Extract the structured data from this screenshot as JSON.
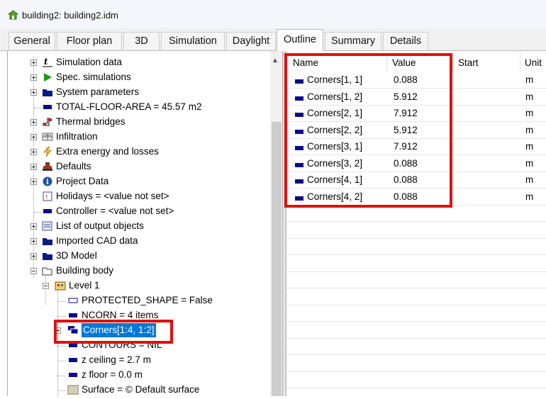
{
  "window": {
    "title": "building2: building2.idm"
  },
  "tabs": [
    "General",
    "Floor plan",
    "3D",
    "Simulation",
    "Daylight",
    "Outline",
    "Summary",
    "Details"
  ],
  "active_tab": "Outline",
  "tree": [
    {
      "label": "Simulation data",
      "icon": "time-icon"
    },
    {
      "label": "Spec. simulations",
      "icon": "play-icon"
    },
    {
      "label": "System parameters",
      "icon": "folder-icon"
    },
    {
      "label": "TOTAL-FLOOR-AREA = 45.57 m2",
      "icon": "value-icon"
    },
    {
      "label": "Thermal bridges",
      "icon": "thermal-bridge-icon"
    },
    {
      "label": "Infiltration",
      "icon": "infiltration-icon"
    },
    {
      "label": "Extra energy and losses",
      "icon": "lightning-icon"
    },
    {
      "label": "Defaults",
      "icon": "defaults-icon"
    },
    {
      "label": "Project Data",
      "icon": "info-icon"
    },
    {
      "label": "Holidays = <value not set>",
      "icon": "calendar-icon"
    },
    {
      "label": "Controller = <value not set>",
      "icon": "value-icon"
    },
    {
      "label": "List of output objects",
      "icon": "output-list-icon"
    },
    {
      "label": "Imported CAD data",
      "icon": "folder-icon"
    },
    {
      "label": "3D Model",
      "icon": "folder-icon"
    },
    {
      "label": "Building body",
      "icon": "open-folder-icon"
    },
    {
      "label": "Level 1",
      "icon": "level-icon"
    },
    {
      "label": "PROTECTED_SHAPE = False",
      "icon": "value-outline-icon"
    },
    {
      "label": "NCORN = 4 items",
      "icon": "value-icon"
    },
    {
      "label": "Corners[1:4, 1:2]",
      "icon": "array-icon"
    },
    {
      "label": "CONTOURS = NIL",
      "icon": "value-icon"
    },
    {
      "label": "z ceiling = 2.7 m",
      "icon": "value-icon"
    },
    {
      "label": "z floor = 0.0 m",
      "icon": "value-icon"
    },
    {
      "label": "Surface = © Default surface",
      "icon": "surface-icon"
    }
  ],
  "grid": {
    "columns": [
      "Name",
      "Value",
      "Start",
      "Unit"
    ],
    "rows": [
      {
        "name": "Corners[1, 1]",
        "value": "0.088",
        "unit": "m"
      },
      {
        "name": "Corners[1, 2]",
        "value": "5.912",
        "unit": "m"
      },
      {
        "name": "Corners[2, 1]",
        "value": "7.912",
        "unit": "m"
      },
      {
        "name": "Corners[2, 2]",
        "value": "5.912",
        "unit": "m"
      },
      {
        "name": "Corners[3, 1]",
        "value": "7.912",
        "unit": "m"
      },
      {
        "name": "Corners[3, 2]",
        "value": "0.088",
        "unit": "m"
      },
      {
        "name": "Corners[4, 1]",
        "value": "0.088",
        "unit": "m"
      },
      {
        "name": "Corners[4, 2]",
        "value": "0.088",
        "unit": "m"
      }
    ]
  },
  "colors": {
    "selection": "#0078d7",
    "highlight_box": "#e01010",
    "value_icon": "#0a0a8c"
  }
}
